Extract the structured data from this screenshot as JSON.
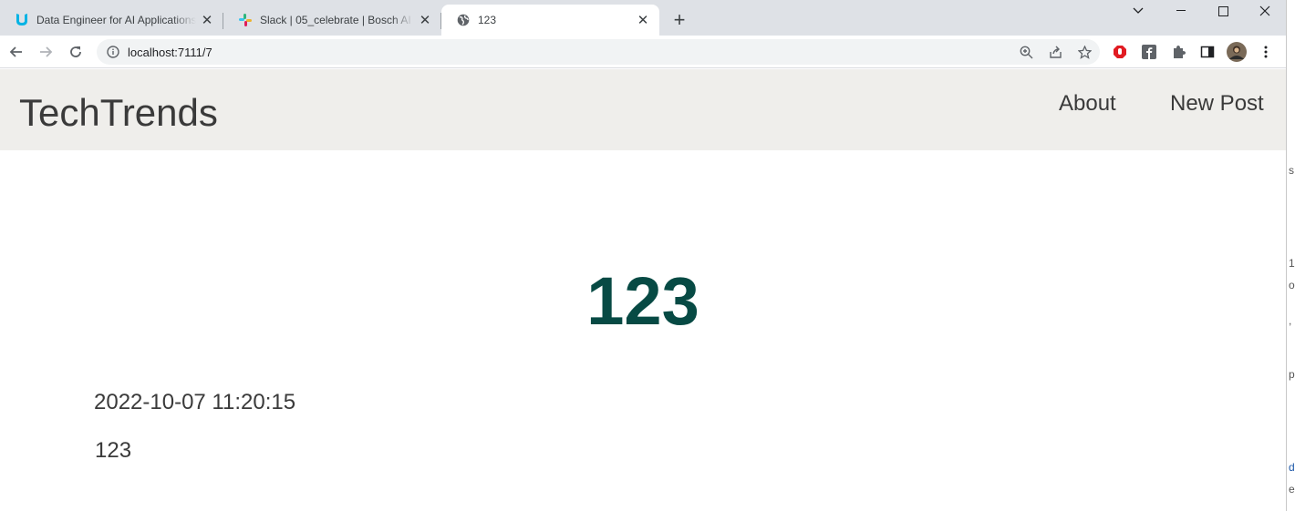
{
  "browser": {
    "tabs": [
      {
        "title": "Data Engineer for AI Applications",
        "favicon": "udacity-icon"
      },
      {
        "title": "Slack | 05_celebrate | Bosch AI Ta",
        "favicon": "slack-icon"
      },
      {
        "title": "123",
        "favicon": "globe-icon",
        "active": true
      }
    ],
    "url": "localhost:7111/7"
  },
  "site": {
    "brand": "TechTrends",
    "nav": {
      "about": "About",
      "new_post": "New Post"
    }
  },
  "post": {
    "title": "123",
    "created": "2022-10-07 11:20:15",
    "content": "123"
  },
  "colors": {
    "nav_background": "#efeeeb",
    "title_color": "#074a44",
    "text_color": "#3a3a3a"
  }
}
